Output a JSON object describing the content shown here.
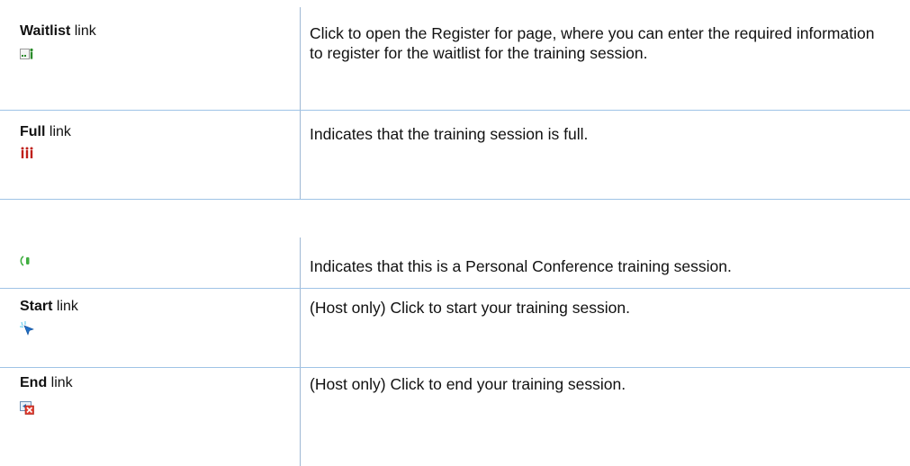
{
  "table1": {
    "rows": [
      {
        "term_bold": "Waitlist",
        "term_suffix": " link",
        "icon": "waitlist-icon",
        "description": "Click to open the Register for page, where you can enter the required information to register for the waitlist for the training session."
      },
      {
        "term_bold": "Full",
        "term_suffix": " link",
        "icon": "full-session-icon",
        "description": "Indicates that the training session is full."
      }
    ]
  },
  "table2": {
    "rows": [
      {
        "icon": "personal-conference-icon",
        "description": "Indicates that this is a Personal Conference training session."
      },
      {
        "term_bold": "Start",
        "term_suffix": " link",
        "icon": "start-icon",
        "description": "(Host only) Click to start your training session."
      },
      {
        "term_bold": "End",
        "term_suffix": " link",
        "icon": "end-icon",
        "description": "(Host only) Click to end your training session."
      }
    ]
  },
  "colors": {
    "rule": "#9fc3e6",
    "full_icon_red": "#c0201a",
    "waitlist_icon_green": "#2a8a2a"
  }
}
